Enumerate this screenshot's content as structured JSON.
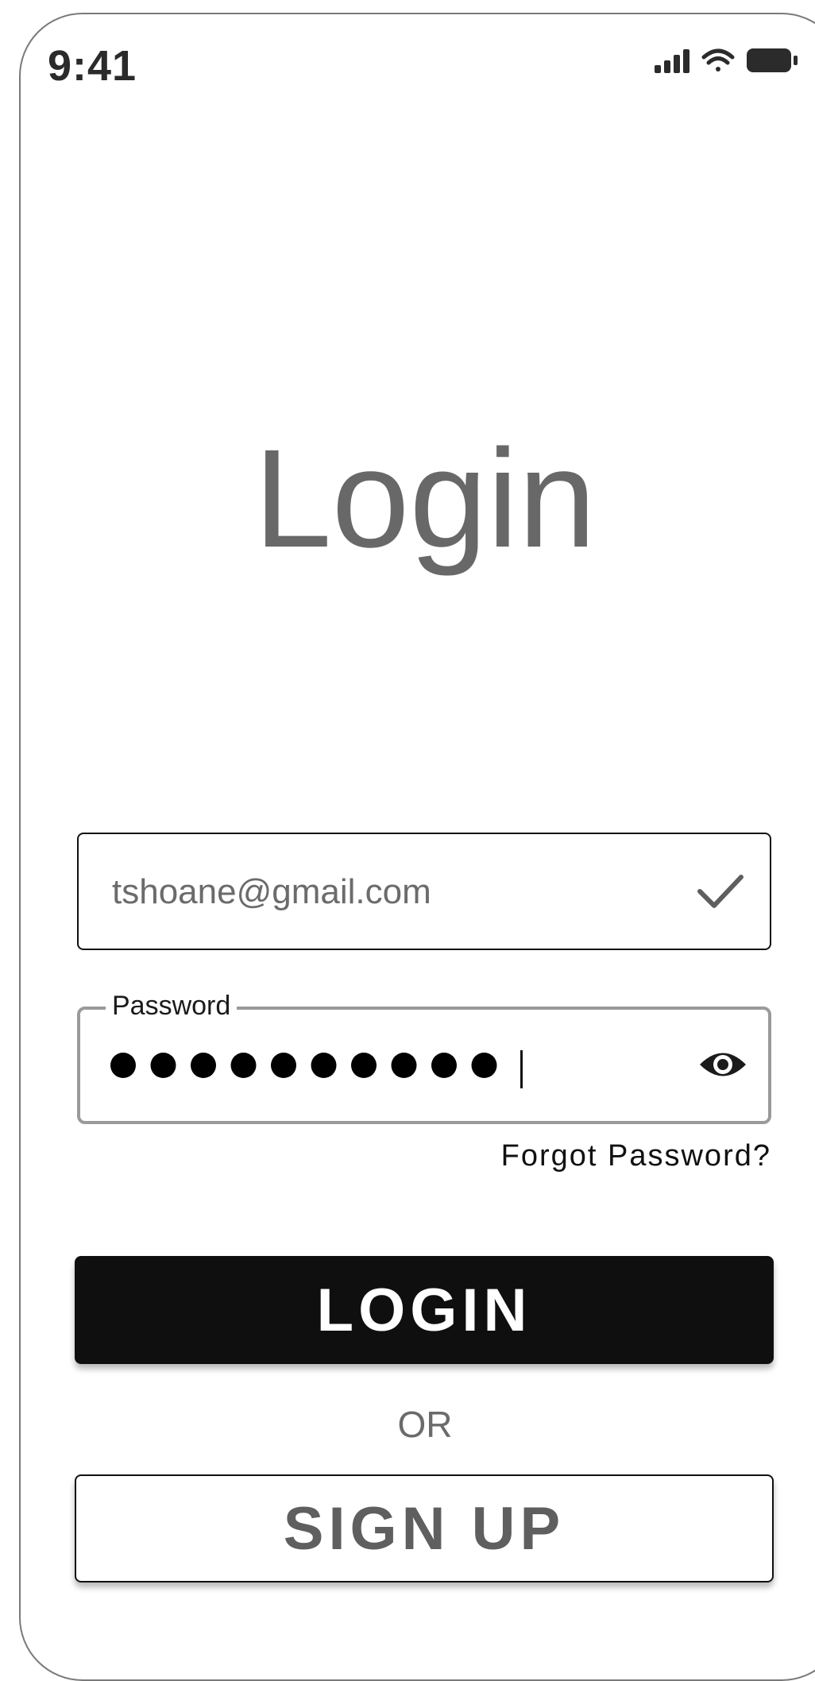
{
  "status_bar": {
    "time": "9:41",
    "icons": [
      "signal-icon",
      "wifi-icon",
      "battery-icon"
    ]
  },
  "title": "Login",
  "email_field": {
    "value": "tshoane@gmail.com",
    "status_icon": "check-icon"
  },
  "password_field": {
    "label": "Password",
    "masked_length": 10,
    "toggle_icon": "eye-icon"
  },
  "forgot_password": "Forgot Password?",
  "login_button": "LOGIN",
  "separator": "OR",
  "signup_button": "SIGN UP",
  "colors": {
    "primary_button_bg": "#0f0f0f",
    "text_gray": "#6b6b6b",
    "border_dark": "#111111",
    "border_light": "#9a9a9a"
  }
}
